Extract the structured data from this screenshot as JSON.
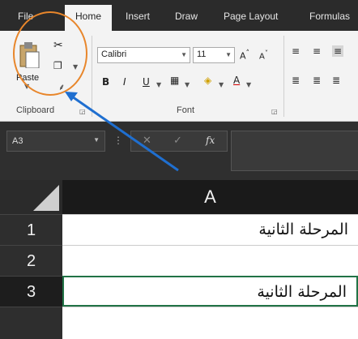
{
  "ribbon_tabs": [
    "File",
    "Home",
    "Insert",
    "Draw",
    "Page Layout",
    "Formulas"
  ],
  "clipboard": {
    "paste_label": "Paste",
    "group_label": "Clipboard"
  },
  "font": {
    "name": "Calibri",
    "size": "11",
    "group_label": "Font",
    "bold": "B",
    "italic": "I",
    "underline": "U"
  },
  "formula_bar": {
    "name_box": "A3",
    "fx": "fx",
    "cancel": "✕",
    "enter": "✓"
  },
  "grid": {
    "column_header": "A",
    "rows": [
      {
        "row": "1",
        "value": "المرحلة الثانية"
      },
      {
        "row": "2",
        "value": ""
      },
      {
        "row": "3",
        "value": "المرحلة الثانية"
      }
    ]
  },
  "colors": {
    "accent": "#217346",
    "annotation": "#e8862b",
    "arrow": "#1f6fd0"
  }
}
